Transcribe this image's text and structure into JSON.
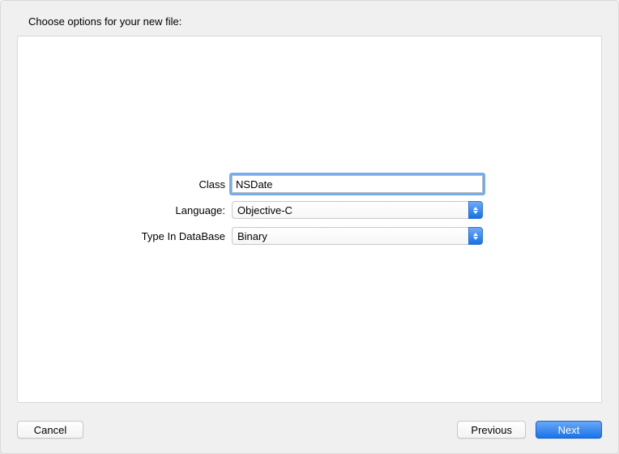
{
  "header": "Choose options for your new file:",
  "form": {
    "class": {
      "label": "Class",
      "value": "NSDate"
    },
    "language": {
      "label": "Language:",
      "value": "Objective-C"
    },
    "typeInDatabase": {
      "label": "Type In DataBase",
      "value": "Binary"
    }
  },
  "buttons": {
    "cancel": "Cancel",
    "previous": "Previous",
    "next": "Next"
  }
}
